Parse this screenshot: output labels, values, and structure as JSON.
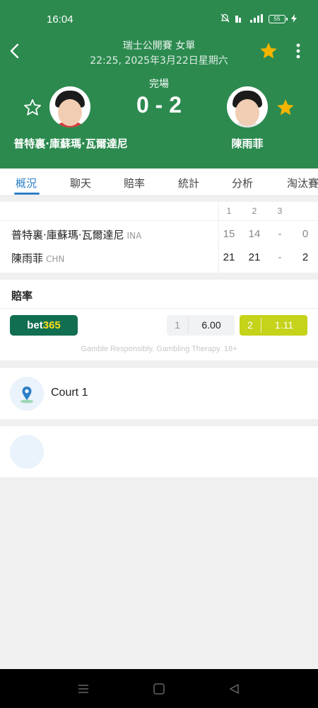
{
  "statusbar": {
    "time": "16:04",
    "battery": "55"
  },
  "header": {
    "tournament": "瑞士公開賽 女單",
    "datetime": "22:25, 2025年3月22日星期六",
    "status": "完場",
    "score": "0 - 2",
    "player_left": "普特裏·庫蘇瑪·瓦爾達尼",
    "player_right": "陳雨菲",
    "accent": "#2c8a4f"
  },
  "tabs": [
    "概況",
    "聊天",
    "賠率",
    "統計",
    "分析",
    "淘汰賽"
  ],
  "scoreboard": {
    "columns": [
      "1",
      "2",
      "3"
    ],
    "rows": [
      {
        "name": "普特裏·庫蘇瑪·瓦爾達尼",
        "country": "INA",
        "sets": [
          "15",
          "14",
          "-"
        ],
        "total": "0"
      },
      {
        "name": "陳雨菲",
        "country": "CHN",
        "sets": [
          "21",
          "21",
          "-"
        ],
        "total": "2"
      }
    ]
  },
  "odds": {
    "title": "賠率",
    "bookmaker_a": "bet",
    "bookmaker_b": "365",
    "opt1_label": "1",
    "opt1_value": "6.00",
    "opt2_label": "2",
    "opt2_value": "1.11",
    "disclaimer": "Gamble Responsibly. Gambling Therapy. 18+"
  },
  "venue": {
    "name": "Court 1"
  }
}
